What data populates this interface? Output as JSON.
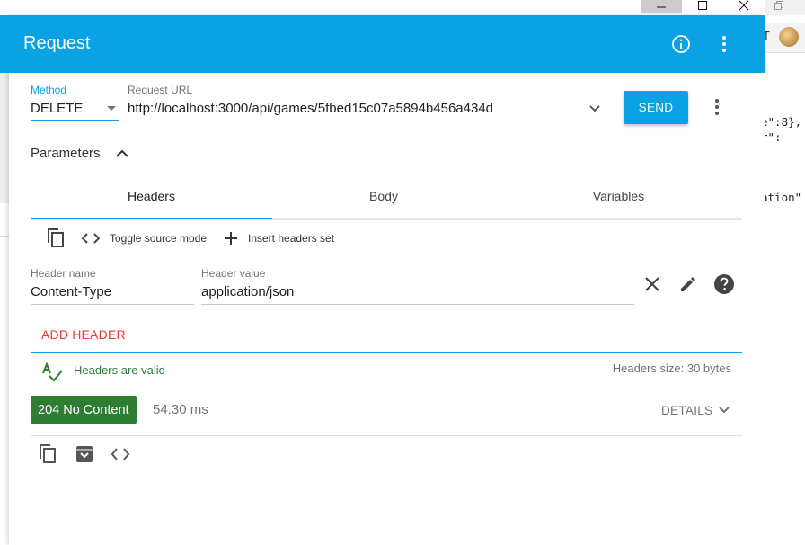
{
  "window": {
    "minimize_icon": "minimize-icon",
    "maximize_icon": "maximize-icon",
    "close_icon": "close-icon"
  },
  "background": {
    "right_top_text": "T",
    "code_lines": [
      "e\":8},",
      "r\":",
      "ation\""
    ]
  },
  "app_bar": {
    "title": "Request",
    "info_icon": "info-icon",
    "more_icon": "more-vert-icon"
  },
  "request": {
    "method_label": "Method",
    "method_value": "DELETE",
    "url_label": "Request URL",
    "url_value": "http://localhost:3000/api/games/5fbed15c07a5894b456a434d",
    "send_label": "SEND"
  },
  "parameters": {
    "label": "Parameters",
    "tabs": [
      {
        "label": "Headers",
        "active": true
      },
      {
        "label": "Body",
        "active": false
      },
      {
        "label": "Variables",
        "active": false
      }
    ],
    "toolbar": {
      "toggle_source_label": "Toggle source mode",
      "insert_set_label": "Insert headers set"
    },
    "header": {
      "name_label": "Header name",
      "name_value": "Content-Type",
      "value_label": "Header value",
      "value_value": "application/json"
    },
    "add_header_label": "ADD HEADER",
    "valid_text": "Headers are valid",
    "size_text": "Headers size: 30 bytes"
  },
  "response": {
    "status": "204 No Content",
    "timing": "54.30 ms",
    "details_label": "DETAILS"
  },
  "colors": {
    "accent": "#0aa2e3",
    "status_ok": "#2e7d32",
    "add_header": "#e53935"
  }
}
